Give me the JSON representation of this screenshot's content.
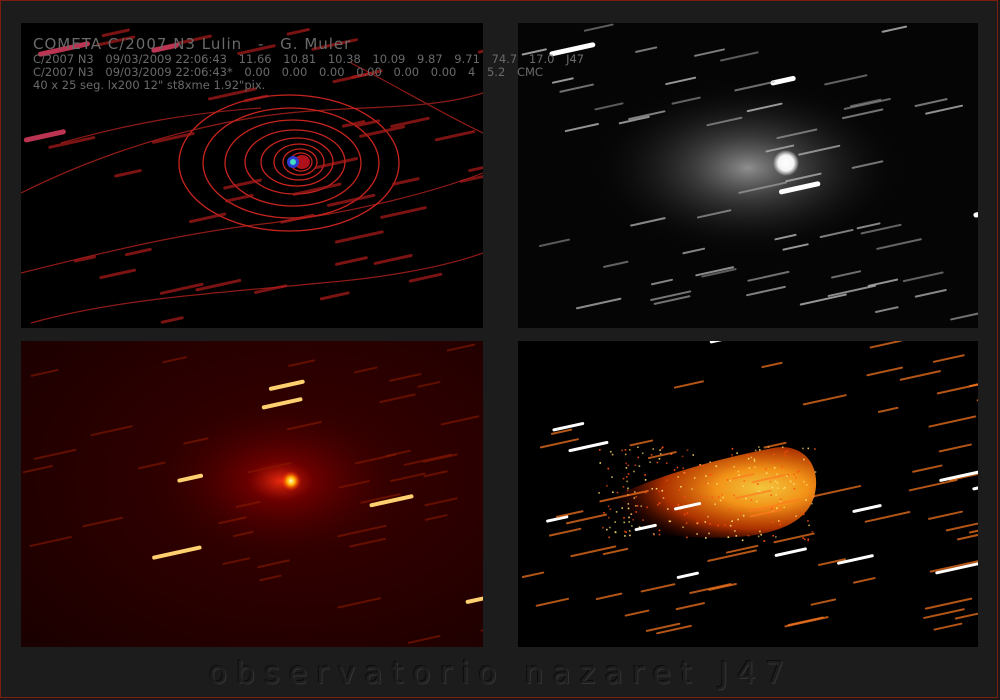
{
  "caption": {
    "title_parts": [
      "COMETA C/2007 N3 Lulin",
      "-",
      "G. Muler"
    ],
    "row1": {
      "object": "C/2007 N3",
      "datetime": "09/03/2009 22:06:43",
      "values": [
        "11.66",
        "10.81",
        "10.38",
        "10.09",
        "9.87",
        "9.71",
        "74.7",
        "17.0",
        "J47"
      ]
    },
    "row2": {
      "object": "C/2007 N3",
      "datetime": "09/03/2009 22:06:43*",
      "values": [
        "0.00",
        "0.00",
        "0.00",
        "0.00",
        "0.00",
        "0.00",
        "4",
        "5.2",
        "CMC"
      ]
    },
    "row3": "40 x 25 seg. lx200 12\" st8xme 1.92\"pix."
  },
  "panels": {
    "top_left": "isophote contour rendering, red contours on black",
    "top_right": "grayscale image, white nucleus with star trails",
    "bottom_left": "red color map with bright nucleus",
    "bottom_right": "processed image showing orange coma and tail"
  },
  "footer": "observatorio nazaret J47",
  "colors": {
    "frame_border": "#7a1e10",
    "contour": "#c0201a",
    "coma": "#ff7a10"
  }
}
